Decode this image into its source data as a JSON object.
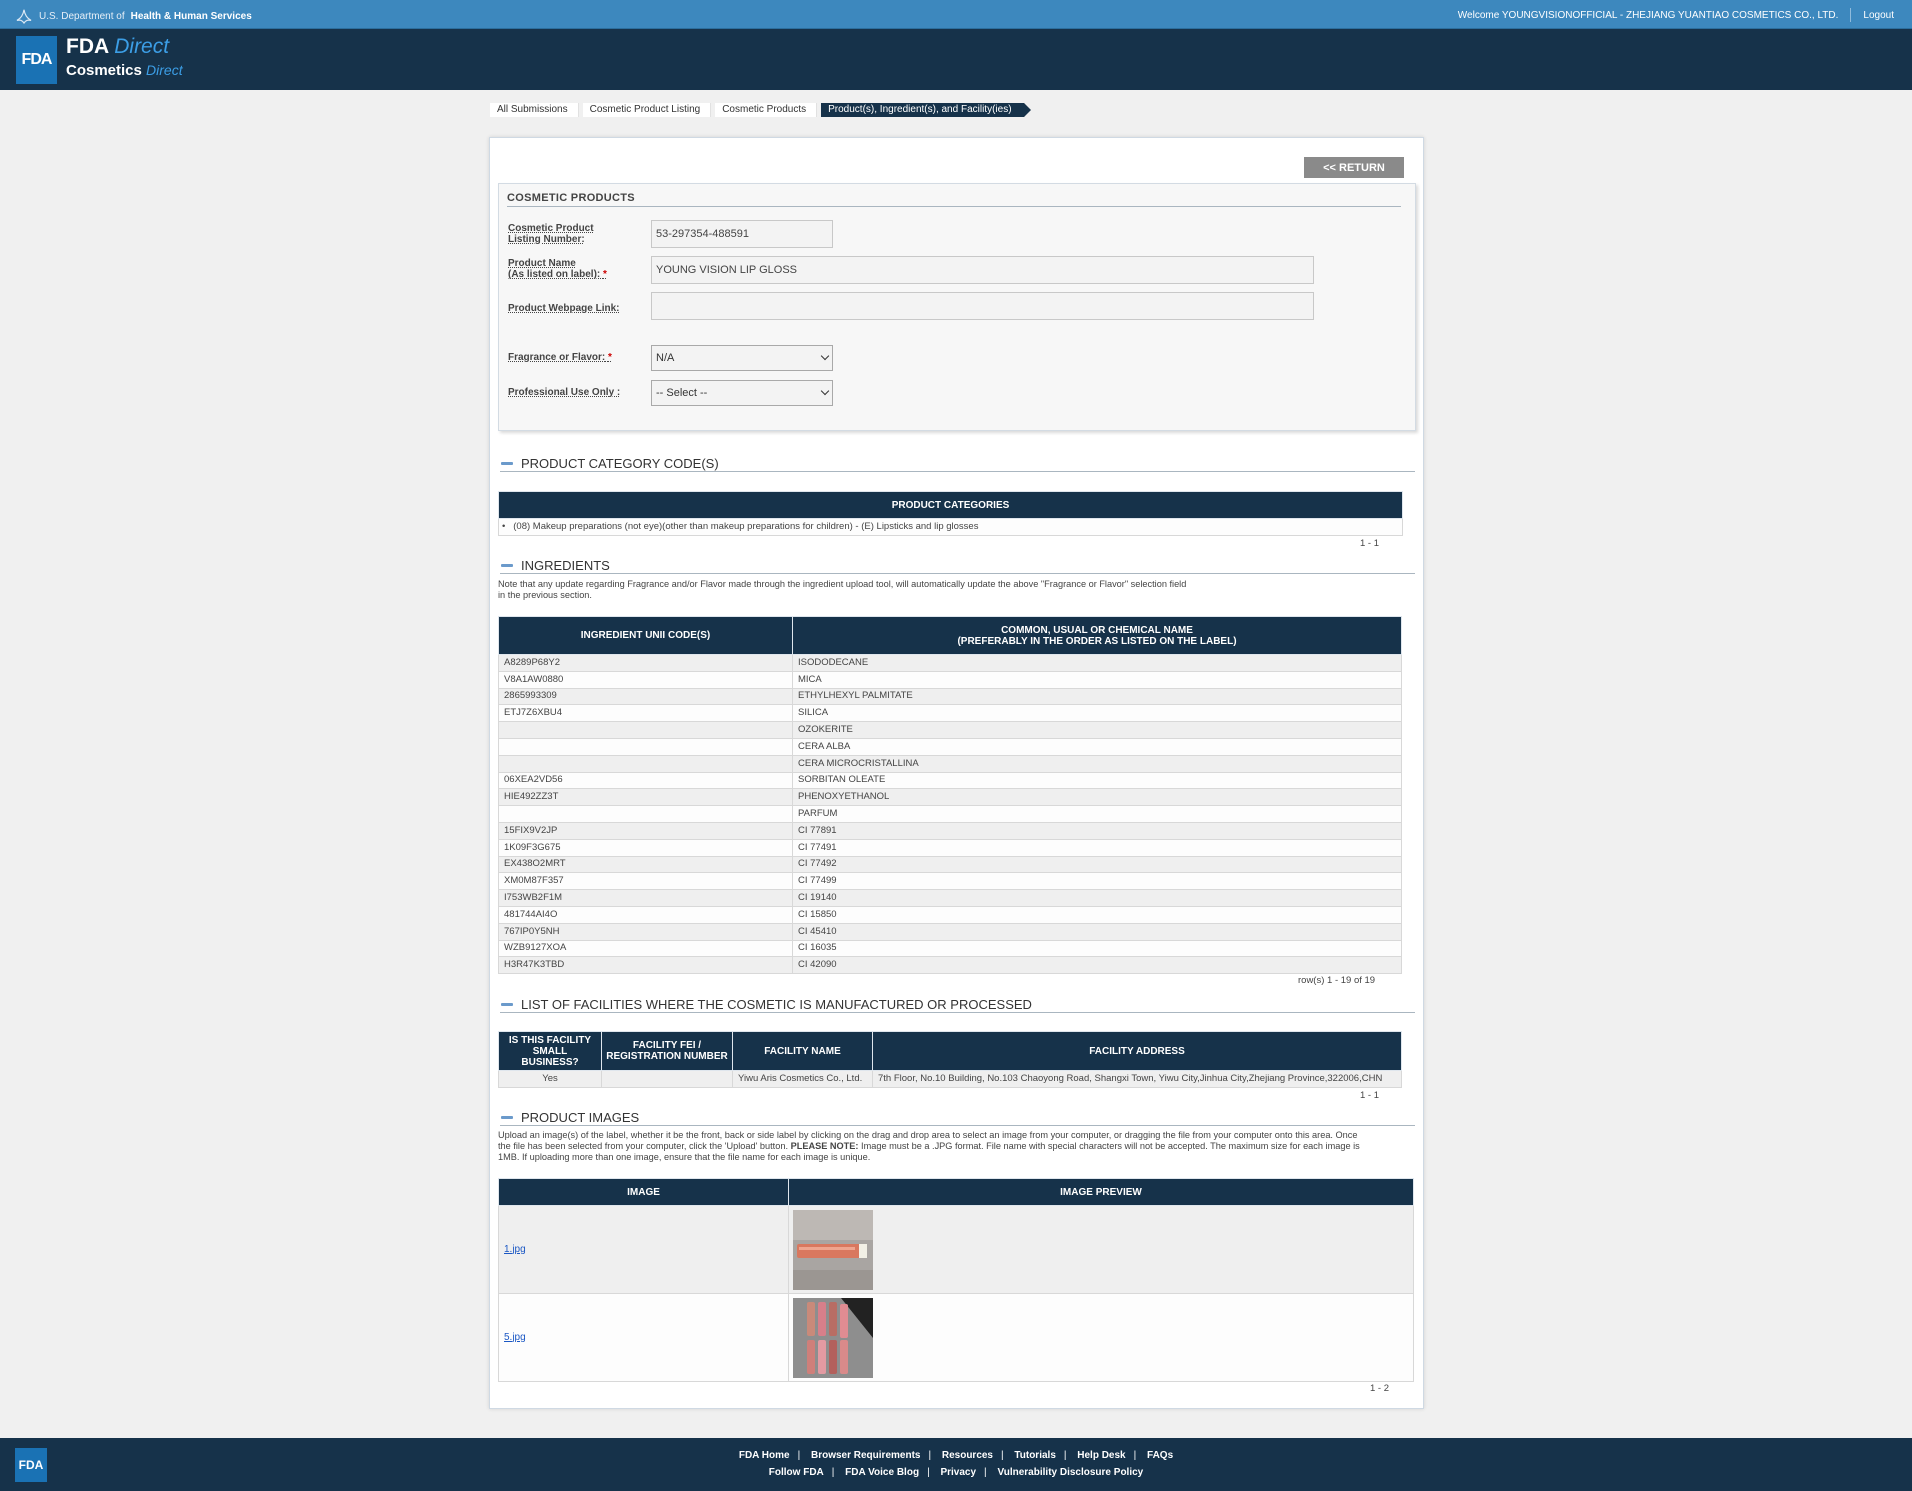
{
  "hhs": {
    "prefix": "U.S. Department of",
    "name": "Health & Human Services",
    "welcome": "Welcome YOUNGVISIONOFFICIAL - ZHEJIANG YUANTIAO COSMETICS CO., LTD.",
    "logout": "Logout"
  },
  "brand": {
    "badge": "FDA",
    "fda": "FDA",
    "direct": "Direct",
    "cosmetics": "Cosmetics",
    "direct2": "Direct"
  },
  "breadcrumb": [
    "All Submissions",
    "Cosmetic Product Listing",
    "Cosmetic Products",
    "Product(s), Ingredient(s), and Facility(ies)"
  ],
  "return_label": "<< RETURN",
  "cosmetic_products": {
    "title": "COSMETIC PRODUCTS",
    "listing_number_label_1": "Cosmetic Product",
    "listing_number_label_2": "Listing Number:",
    "listing_number": "53-297354-488591",
    "product_name_label_1": "Product Name",
    "product_name_label_2": "(As listed on label):",
    "product_name": "YOUNG VISION LIP GLOSS",
    "webpage_label": "Product Webpage Link:",
    "webpage_value": "",
    "fragrance_label": "Fragrance or Flavor:",
    "fragrance_value": "N/A",
    "professional_label": "Professional Use Only :",
    "professional_value": "-- Select --",
    "required_mark": "*"
  },
  "categories": {
    "heading": "PRODUCT CATEGORY CODE(S)",
    "column": "PRODUCT CATEGORIES",
    "bullet": "•",
    "rows": [
      "(08) Makeup preparations (not eye)(other than makeup preparations for children) - (E) Lipsticks and lip glosses"
    ],
    "count": "1 - 1"
  },
  "ingredients": {
    "heading": "INGREDIENTS",
    "note_1": "Note that any update regarding Fragrance and/or Flavor made through the ingredient upload tool, will automatically update the above \"Fragrance or Flavor\" selection field",
    "note_2": "in the previous section.",
    "col_code": "INGREDIENT UNII CODE(S)",
    "col_name_1": "COMMON, USUAL OR CHEMICAL NAME",
    "col_name_2": "(PREFERABLY IN THE ORDER AS LISTED ON THE LABEL)",
    "rows": [
      {
        "code": "A8289P68Y2",
        "name": "ISODODECANE"
      },
      {
        "code": "V8A1AW0880",
        "name": "MICA"
      },
      {
        "code": "2865993309",
        "name": "ETHYLHEXYL PALMITATE"
      },
      {
        "code": "ETJ7Z6XBU4",
        "name": "SILICA"
      },
      {
        "code": "",
        "name": "OZOKERITE"
      },
      {
        "code": "",
        "name": "CERA ALBA"
      },
      {
        "code": "",
        "name": "CERA MICROCRISTALLINA"
      },
      {
        "code": "06XEA2VD56",
        "name": "SORBITAN OLEATE"
      },
      {
        "code": "HIE492ZZ3T",
        "name": "PHENOXYETHANOL"
      },
      {
        "code": "",
        "name": "PARFUM"
      },
      {
        "code": "15FIX9V2JP",
        "name": "CI 77891"
      },
      {
        "code": "1K09F3G675",
        "name": "CI 77491"
      },
      {
        "code": "EX438O2MRT",
        "name": "CI 77492"
      },
      {
        "code": "XM0M87F357",
        "name": "CI 77499"
      },
      {
        "code": "I753WB2F1M",
        "name": "CI 19140"
      },
      {
        "code": "481744AI4O",
        "name": "CI 15850"
      },
      {
        "code": "767IP0Y5NH",
        "name": "CI 45410"
      },
      {
        "code": "WZB9127XOA",
        "name": "CI 16035"
      },
      {
        "code": "H3R47K3TBD",
        "name": "CI 42090"
      }
    ],
    "count": "row(s) 1 - 19 of 19"
  },
  "facilities": {
    "heading": "LIST OF FACILITIES WHERE THE COSMETIC IS MANUFACTURED OR PROCESSED",
    "col_small_1": "IS THIS FACILITY",
    "col_small_2": "SMALL BUSINESS?",
    "col_fei_1": "FACILITY FEI /",
    "col_fei_2": "REGISTRATION NUMBER",
    "col_name": "FACILITY NAME",
    "col_address": "FACILITY ADDRESS",
    "rows": [
      {
        "small": "Yes",
        "fei": "",
        "name": "Yiwu Aris Cosmetics Co., Ltd.",
        "address": "7th Floor, No.10 Building, No.103 Chaoyong Road, Shangxi Town, Yiwu City,Jinhua City,Zhejiang Province,322006,CHN"
      }
    ],
    "count": "1 - 1"
  },
  "images": {
    "heading": "PRODUCT IMAGES",
    "note_1": "Upload an image(s) of the label, whether it be the front, back or side label by clicking on the drag and drop area to select an image from your computer, or dragging the file from your computer onto this area. Once",
    "note_2a": "the file has been selected from your computer, click the 'Upload' button.",
    "note_2b": "PLEASE NOTE:",
    "note_2c": "Image must be a .JPG format. File name with special characters will not be accepted. The maximum size for each image is",
    "note_3": "1MB. If uploading more than one image, ensure that the file name for each image is unique.",
    "col_image": "IMAGE",
    "col_preview": "IMAGE PREVIEW",
    "rows": [
      {
        "file": "1.jpg"
      },
      {
        "file": "5.jpg"
      }
    ],
    "count": "1 - 2"
  },
  "footer": {
    "badge": "FDA",
    "row1": [
      "FDA Home",
      "Browser Requirements",
      "Resources",
      "Tutorials",
      "Help Desk",
      "FAQs"
    ],
    "row2": [
      "Follow FDA",
      "FDA Voice Blog",
      "Privacy",
      "Vulnerability Disclosure Policy"
    ],
    "separator": "|"
  },
  "colors": {
    "hhs_bar": "#3d88be",
    "header": "#16324a",
    "table_header": "#16324a",
    "accent": "#1a72b4",
    "required": "#cc0000",
    "link": "#1a57c4"
  }
}
